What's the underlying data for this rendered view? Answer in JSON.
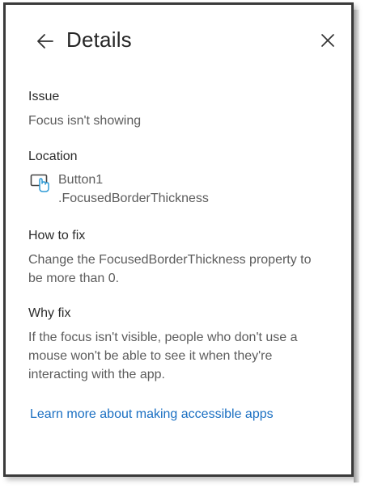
{
  "header": {
    "title": "Details",
    "back_icon": "arrow-left-icon",
    "close_icon": "close-icon"
  },
  "issue": {
    "heading": "Issue",
    "text": "Focus isn't showing"
  },
  "location": {
    "heading": "Location",
    "icon": "button-cursor-icon",
    "line1": "Button1",
    "line2": ".FocusedBorderThickness"
  },
  "how_to_fix": {
    "heading": "How to fix",
    "line1": "Change the FocusedBorderThickness property to",
    "line2": "be more than 0."
  },
  "why_fix": {
    "heading": "Why fix",
    "line1": "If the focus isn't visible, people who don't use a",
    "line2": "mouse won't be able to see it when they're",
    "line3": "interacting with the app."
  },
  "link": {
    "label": "Learn more about making accessible apps",
    "color": "#1a6fc2"
  }
}
